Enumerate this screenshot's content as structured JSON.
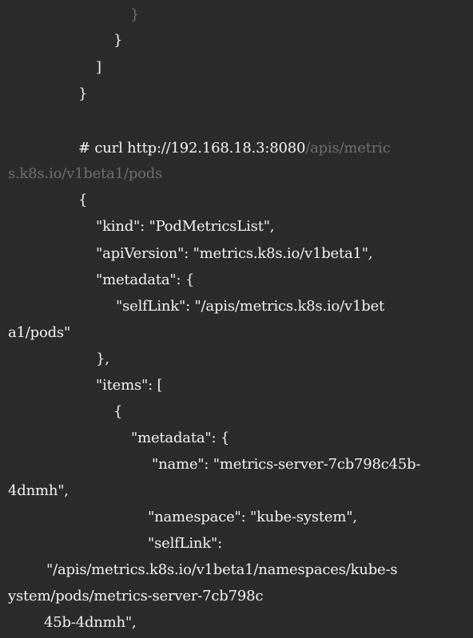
{
  "terminal": {
    "lines": [
      {
        "bright": "",
        "dim": "}"
      },
      {
        "bright": "}",
        "dim": ""
      },
      {
        "bright": "]",
        "dim": ""
      },
      {
        "bright": "}",
        "dim": ""
      },
      {
        "bright": "# curl http://192.168.18.3:8080",
        "dim": "/apis/metric"
      },
      {
        "bright": "",
        "dim": "s.k8s.io/v1beta1/pods"
      },
      {
        "bright": "{",
        "dim": ""
      },
      {
        "bright": "\"kind\": \"PodMetricsList\",",
        "dim": ""
      },
      {
        "bright": "\"apiVersion\": \"metrics.k8s.io/v1beta1\",",
        "dim": ""
      },
      {
        "bright": "\"metadata\": {",
        "dim": ""
      },
      {
        "bright": "\"selfLink\": \"/apis/metrics.k8s.io/v1bet",
        "dim": ""
      },
      {
        "bright": "a1/pods\"",
        "dim": ""
      },
      {
        "bright": "},",
        "dim": ""
      },
      {
        "bright": "\"items\": [",
        "dim": ""
      },
      {
        "bright": "{",
        "dim": ""
      },
      {
        "bright": "\"metadata\": {",
        "dim": ""
      },
      {
        "bright": "\"name\": \"metrics-server-7cb798c45b-",
        "dim": ""
      },
      {
        "bright": "4dnmh\",",
        "dim": ""
      },
      {
        "bright": "\"namespace\": \"kube-system\",",
        "dim": ""
      },
      {
        "bright": "\"selfLink\":",
        "dim": ""
      },
      {
        "bright": "\"/apis/metrics.k8s.io/v1beta1/namespaces/kube-s",
        "dim": ""
      },
      {
        "bright": "ystem/pods/metrics-server-7cb798c",
        "dim": ""
      },
      {
        "bright": "45b-4dnmh\",",
        "dim": ""
      }
    ]
  },
  "colors": {
    "background": "#2b2b2b",
    "text": "#f3f3f3",
    "dim_text": "#6f6f6f"
  }
}
